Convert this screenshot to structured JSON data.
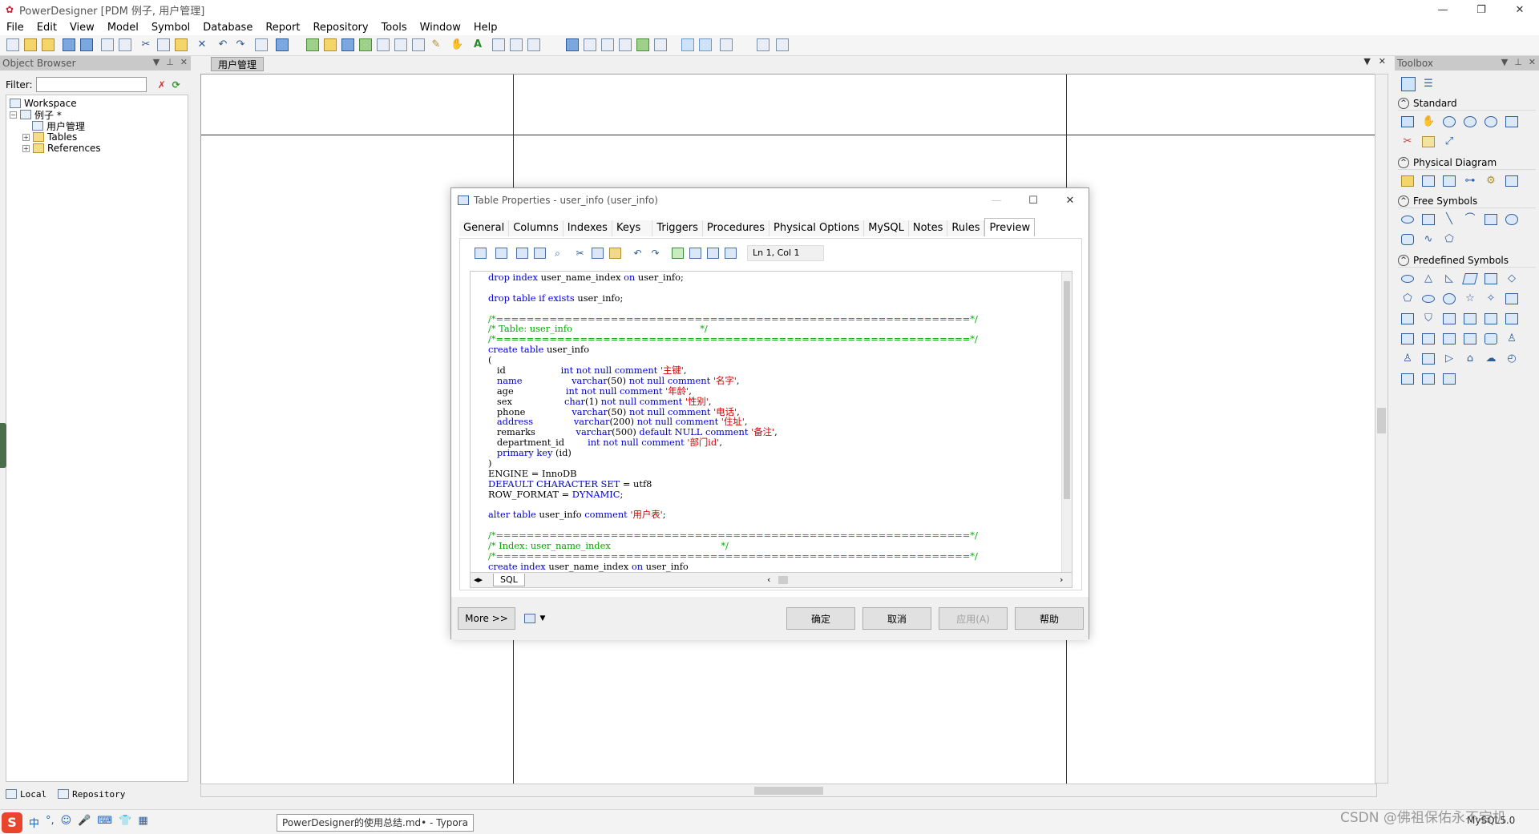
{
  "app": {
    "title": "PowerDesigner [PDM 例子, 用户管理]",
    "window_controls": {
      "minimize": "—",
      "restore": "❐",
      "close": "✕"
    }
  },
  "menu": [
    "File",
    "Edit",
    "View",
    "Model",
    "Symbol",
    "Database",
    "Report",
    "Repository",
    "Tools",
    "Window",
    "Help"
  ],
  "object_browser": {
    "title": "Object Browser",
    "filter_label": "Filter:",
    "filter_value": "",
    "tree": {
      "workspace": "Workspace",
      "model": "例子 *",
      "diagram": "用户管理",
      "tables": "Tables",
      "references": "References"
    },
    "bottom_tabs": {
      "local": "Local",
      "repository": "Repository"
    }
  },
  "document": {
    "tab": "用户管理"
  },
  "toolbox": {
    "title": "Toolbox",
    "sections": {
      "standard": "Standard",
      "physical": "Physical Diagram",
      "free": "Free Symbols",
      "predefined": "Predefined Symbols"
    }
  },
  "dialog": {
    "title": "Table Properties - user_info (user_info)",
    "tabs": [
      "General",
      "Columns",
      "Indexes",
      "Keys",
      "Triggers",
      "Procedures",
      "Physical Options",
      "MySQL",
      "Notes",
      "Rules",
      "Preview"
    ],
    "active_tab": "Preview",
    "cursor_pos": "Ln 1, Col 1",
    "sql_tab": "SQL",
    "sql_lines": [
      [
        {
          "t": "drop index ",
          "c": "kw"
        },
        {
          "t": "user_name_index ",
          "c": ""
        },
        {
          "t": "on ",
          "c": "kw"
        },
        {
          "t": "user_info;",
          "c": ""
        }
      ],
      [
        {
          "t": "",
          "c": ""
        }
      ],
      [
        {
          "t": "drop table if exists ",
          "c": "kw"
        },
        {
          "t": "user_info;",
          "c": ""
        }
      ],
      [
        {
          "t": "",
          "c": ""
        }
      ],
      [
        {
          "t": "/*==============================================================*/",
          "c": "cm"
        }
      ],
      [
        {
          "t": "/* Table: user_info                                            */",
          "c": "cm"
        }
      ],
      [
        {
          "t": "/*==============================================================*/",
          "c": "cm"
        }
      ],
      [
        {
          "t": "create table ",
          "c": "kw"
        },
        {
          "t": "user_info",
          "c": ""
        }
      ],
      [
        {
          "t": "(",
          "c": ""
        }
      ],
      [
        {
          "t": "   id                   ",
          "c": ""
        },
        {
          "t": "int not null comment ",
          "c": "kw"
        },
        {
          "t": "'主键'",
          "c": "st"
        },
        {
          "t": ",",
          "c": ""
        }
      ],
      [
        {
          "t": "   name                 ",
          "c": "kw"
        },
        {
          "t": "varchar",
          "c": "kw"
        },
        {
          "t": "(50) ",
          "c": ""
        },
        {
          "t": "not null comment ",
          "c": "kw"
        },
        {
          "t": "'名字'",
          "c": "st"
        },
        {
          "t": ",",
          "c": ""
        }
      ],
      [
        {
          "t": "   age                  ",
          "c": ""
        },
        {
          "t": "int not null comment ",
          "c": "kw"
        },
        {
          "t": "'年龄'",
          "c": "st"
        },
        {
          "t": ",",
          "c": ""
        }
      ],
      [
        {
          "t": "   sex                  ",
          "c": ""
        },
        {
          "t": "char",
          "c": "kw"
        },
        {
          "t": "(1) ",
          "c": ""
        },
        {
          "t": "not null comment ",
          "c": "kw"
        },
        {
          "t": "'性别'",
          "c": "st"
        },
        {
          "t": ",",
          "c": ""
        }
      ],
      [
        {
          "t": "   phone                ",
          "c": ""
        },
        {
          "t": "varchar",
          "c": "kw"
        },
        {
          "t": "(50) ",
          "c": ""
        },
        {
          "t": "not null comment ",
          "c": "kw"
        },
        {
          "t": "'电话'",
          "c": "st"
        },
        {
          "t": ",",
          "c": ""
        }
      ],
      [
        {
          "t": "   address              ",
          "c": "kw"
        },
        {
          "t": "varchar",
          "c": "kw"
        },
        {
          "t": "(200) ",
          "c": ""
        },
        {
          "t": "not null comment ",
          "c": "kw"
        },
        {
          "t": "'住址'",
          "c": "st"
        },
        {
          "t": ",",
          "c": ""
        }
      ],
      [
        {
          "t": "   remarks              ",
          "c": ""
        },
        {
          "t": "varchar",
          "c": "kw"
        },
        {
          "t": "(500) ",
          "c": ""
        },
        {
          "t": "default NULL comment ",
          "c": "kw"
        },
        {
          "t": "'备注'",
          "c": "st"
        },
        {
          "t": ",",
          "c": ""
        }
      ],
      [
        {
          "t": "   department_id        ",
          "c": ""
        },
        {
          "t": "int not null comment ",
          "c": "kw"
        },
        {
          "t": "'部门id'",
          "c": "st"
        },
        {
          "t": ",",
          "c": ""
        }
      ],
      [
        {
          "t": "   primary key ",
          "c": "kw"
        },
        {
          "t": "(id)",
          "c": ""
        }
      ],
      [
        {
          "t": ")",
          "c": ""
        }
      ],
      [
        {
          "t": "ENGINE = InnoDB",
          "c": ""
        }
      ],
      [
        {
          "t": "DEFAULT CHARACTER SET",
          "c": "kw"
        },
        {
          "t": " = utf8",
          "c": ""
        }
      ],
      [
        {
          "t": "ROW_FORMAT = ",
          "c": ""
        },
        {
          "t": "DYNAMIC",
          "c": "kw"
        },
        {
          "t": ";",
          "c": ""
        }
      ],
      [
        {
          "t": "",
          "c": ""
        }
      ],
      [
        {
          "t": "alter table ",
          "c": "kw"
        },
        {
          "t": "user_info ",
          "c": ""
        },
        {
          "t": "comment ",
          "c": "kw"
        },
        {
          "t": "'用户表'",
          "c": "st"
        },
        {
          "t": ";",
          "c": ""
        }
      ],
      [
        {
          "t": "",
          "c": ""
        }
      ],
      [
        {
          "t": "/*==============================================================*/",
          "c": "cm"
        }
      ],
      [
        {
          "t": "/* Index: user_name_index                                      */",
          "c": "cm"
        }
      ],
      [
        {
          "t": "/*==============================================================*/",
          "c": "cm"
        }
      ],
      [
        {
          "t": "create index ",
          "c": "kw"
        },
        {
          "t": "user_name_index ",
          "c": ""
        },
        {
          "t": "on ",
          "c": "kw"
        },
        {
          "t": "user_info",
          "c": ""
        }
      ]
    ],
    "buttons": {
      "more": "More >>",
      "ok": "确定",
      "cancel": "取消",
      "apply": "应用(A)",
      "help": "帮助"
    }
  },
  "taskbar": {
    "ime_logo": "S",
    "ime_items": [
      "中",
      "°,",
      "☺",
      "🎤",
      "⌨",
      "👕",
      "▦"
    ],
    "window": "PowerDesigner的使用总结.md• - Typora",
    "watermark": "CSDN @佛祖保佑永不宕机",
    "mysql_tag": "MySQL5.0"
  },
  "colors": {
    "keyword": "#0000d0",
    "comment": "#00a800",
    "string": "#d00000"
  }
}
